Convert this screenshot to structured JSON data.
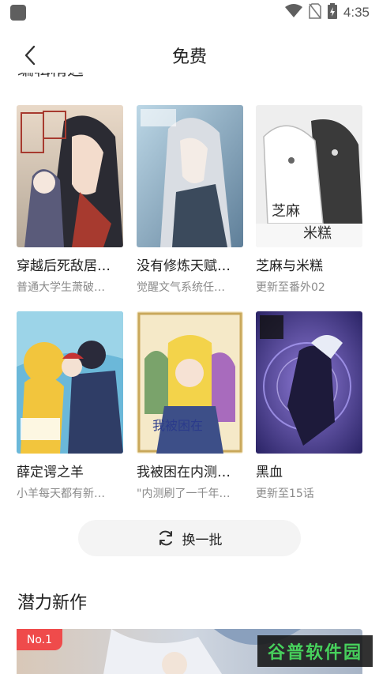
{
  "status_bar": {
    "time": "4:35",
    "icons": [
      "wifi-icon",
      "no-sim-icon",
      "battery-charging-icon"
    ]
  },
  "header": {
    "back_icon": "chevron-left-icon",
    "title": "免费"
  },
  "previous_section_title_clipped": "编辑精选",
  "comics": [
    {
      "title": "穿越后死敌居…",
      "subtitle": "普通大学生萧破…",
      "cover_accent": "#a73a2f"
    },
    {
      "title": "没有修炼天赋…",
      "subtitle": "觉醒文气系统任…",
      "cover_accent": "#4a6c8a"
    },
    {
      "title": "芝麻与米糕",
      "subtitle": "更新至番外02",
      "cover_accent": "#6c6c6c"
    },
    {
      "title": "薛定谔之羊",
      "subtitle": "小羊每天都有新…",
      "cover_accent": "#f2c53d"
    },
    {
      "title": "我被困在内测…",
      "subtitle": "\"内测刷了一千年…",
      "cover_accent": "#c9a85b"
    },
    {
      "title": "黑血",
      "subtitle": "更新至15话",
      "cover_accent": "#4b3f9a"
    }
  ],
  "refresh_button": {
    "label": "换一批",
    "icon": "refresh-icon"
  },
  "new_section": {
    "title": "潜力新作",
    "badge": "No.1",
    "watermark": "谷普软件园"
  }
}
